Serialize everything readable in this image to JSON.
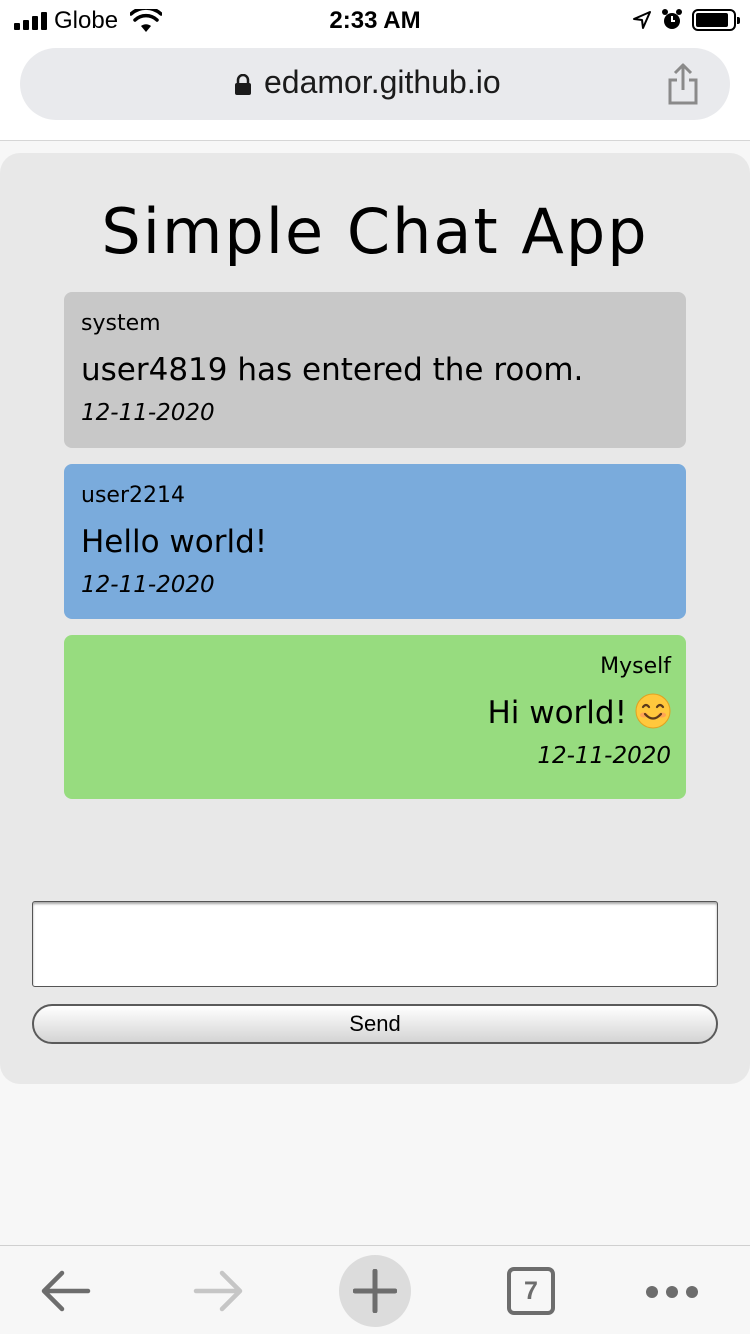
{
  "status_bar": {
    "carrier": "Globe",
    "time": "2:33 AM"
  },
  "browser": {
    "url": "edamor.github.io",
    "open_tab_count": "7"
  },
  "app": {
    "title": "Simple Chat App",
    "messages": [
      {
        "user": "system",
        "text": "user4819 has entered the room.",
        "date": "12-11-2020",
        "color": "#c8c8c8"
      },
      {
        "user": "user2214",
        "text": "Hello world!",
        "date": "12-11-2020",
        "color": "#7aabdc"
      },
      {
        "user": "Myself",
        "text": "Hi world!",
        "date": "12-11-2020",
        "color": "#97dc7f",
        "emoji": "smiling-face-icon"
      }
    ],
    "input": {
      "value": "",
      "placeholder": ""
    },
    "send_label": "Send"
  },
  "icons": {
    "status": [
      "signal-icon",
      "wifi-icon",
      "location-icon",
      "alarm-icon",
      "battery-icon"
    ],
    "url_bar": [
      "lock-icon",
      "share-icon"
    ],
    "toolbar": [
      "back-arrow-icon",
      "forward-arrow-icon",
      "plus-icon",
      "tabs-icon",
      "more-icon"
    ]
  }
}
